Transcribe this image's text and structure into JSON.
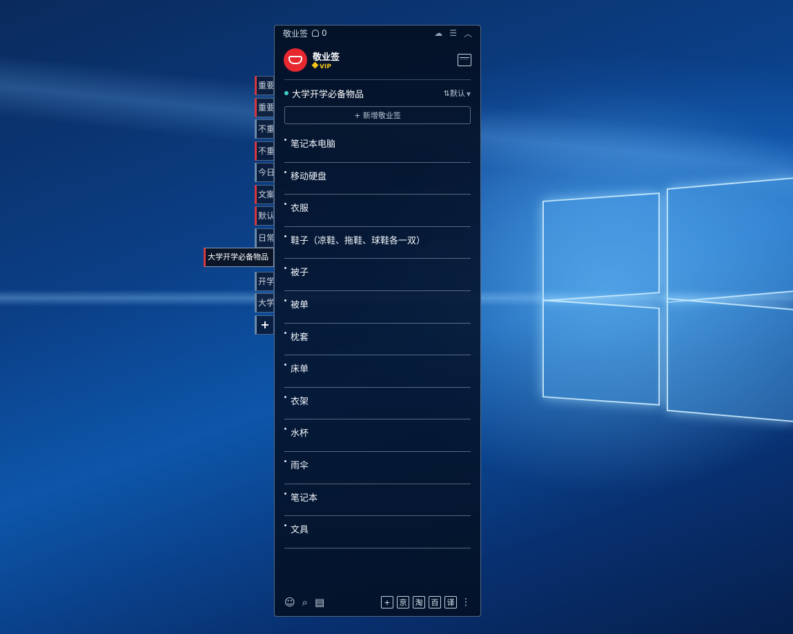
{
  "window": {
    "app_name": "敬业签",
    "notification_count": "0",
    "cloud_icon": "cloud-sync-icon",
    "menu_icon": "hamburger-menu-icon",
    "collapse_icon": "chevron-up-icon"
  },
  "header": {
    "brand": "敬业签",
    "vip_label": "VIP",
    "logo_icon": "jingyeqian-logo",
    "calendar_icon": "calendar-icon",
    "colors": {
      "logo_red": "#e8282f",
      "vip_gold": "#f5c518"
    }
  },
  "side_tags": [
    {
      "label": "重要",
      "color": "#d9363e"
    },
    {
      "label": "重要",
      "color": "#d9363e"
    },
    {
      "label": "不重",
      "color": "#6a8aa9"
    },
    {
      "label": "不重",
      "color": "#d9363e"
    },
    {
      "label": "今日",
      "color": "#6a8aa9"
    },
    {
      "label": "文案",
      "color": "#d9363e"
    },
    {
      "label": "默认",
      "color": "#d9363e"
    },
    {
      "label": "日常",
      "color": "#6a8aa9"
    },
    {
      "label": "开学",
      "color": "#6a8aa9"
    },
    {
      "label": "大学",
      "color": "#6a8aa9"
    }
  ],
  "active_tag": "大学开学必备物品",
  "add_tag_label": "+",
  "list": {
    "title": "大学开学必备物品",
    "sort_label": "⇅默认",
    "add_note_label": "+ 新增敬业签",
    "items": [
      "笔记本电脑",
      "移动硬盘",
      "衣服",
      "鞋子（凉鞋、拖鞋、球鞋各一双）",
      "被子",
      "被单",
      "枕套",
      "床单",
      "衣架",
      "水杯",
      "雨伞",
      "笔记本",
      "文具"
    ]
  },
  "footer": {
    "left_icons": [
      "contacts-icon",
      "search-icon",
      "notes-icon"
    ],
    "right_buttons": [
      "+",
      "京",
      "淘",
      "百",
      "译"
    ],
    "more_icon": "more-vertical-icon"
  }
}
